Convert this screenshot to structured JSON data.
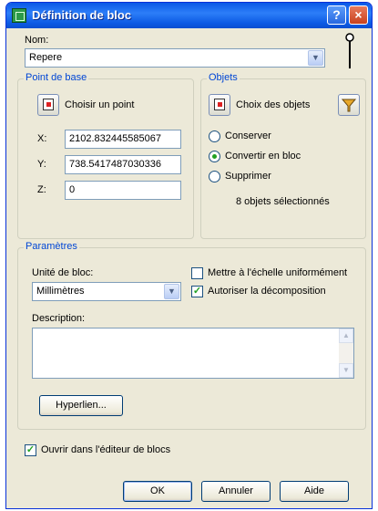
{
  "window": {
    "title": "Définition de bloc",
    "help_glyph": "?",
    "close_glyph": "×"
  },
  "name": {
    "label": "Nom:",
    "value": "Repere",
    "arrow": "▼"
  },
  "base_point": {
    "group_title": "Point de base",
    "pick_label": "Choisir un point",
    "x_label": "X:",
    "x_value": "2102.832445585067",
    "y_label": "Y:",
    "y_value": "738.5417487030336",
    "z_label": "Z:",
    "z_value": "0"
  },
  "objects": {
    "group_title": "Objets",
    "select_label": "Choix des objets",
    "options": [
      "Conserver",
      "Convertir en bloc",
      "Supprimer"
    ],
    "selected_option": "Convertir en bloc",
    "count_text": "8 objets sélectionnés"
  },
  "settings": {
    "group_title": "Paramètres",
    "unit_label": "Unité de bloc:",
    "unit_value": "Millimètres",
    "scale_label": "Mettre à l'échelle uniformément",
    "scale_checked": false,
    "explode_label": "Autoriser la décomposition",
    "explode_checked": true,
    "description_label": "Description:",
    "description_value": "",
    "hyperlink_label": "Hyperlien..."
  },
  "open_editor": {
    "label": "Ouvrir dans l'éditeur de blocs",
    "checked": true
  },
  "buttons": {
    "ok": "OK",
    "cancel": "Annuler",
    "help": "Aide"
  }
}
